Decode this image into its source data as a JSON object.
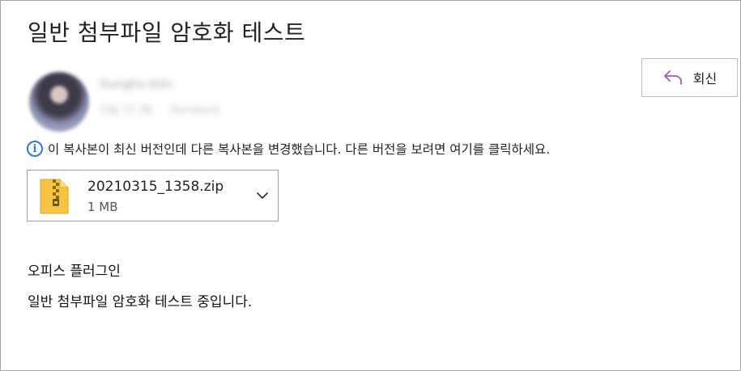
{
  "message": {
    "subject": "일반 첨부파일 암호화 테스트",
    "sender": {
      "name": "Sungho Kim",
      "meta": [
        "오늘 11:36",
        "Someone"
      ]
    },
    "reply_label": "회신",
    "info_text": "이 복사본이 최신 버전인데 다른 복사본을 변경했습니다. 다른 버전을 보려면 여기를 클릭하세요.",
    "attachment": {
      "filename": "20210315_1358.zip",
      "size": "1 MB",
      "icon": "zip-file-icon"
    },
    "body": {
      "line1": "오피스 플러그인",
      "line2": "일반 첨부파일 암호화 테스트 중입니다."
    }
  },
  "colors": {
    "info_blue": "#2b7cd3",
    "reply_purple": "#a157c7",
    "zip_yellow": "#f6c343"
  }
}
